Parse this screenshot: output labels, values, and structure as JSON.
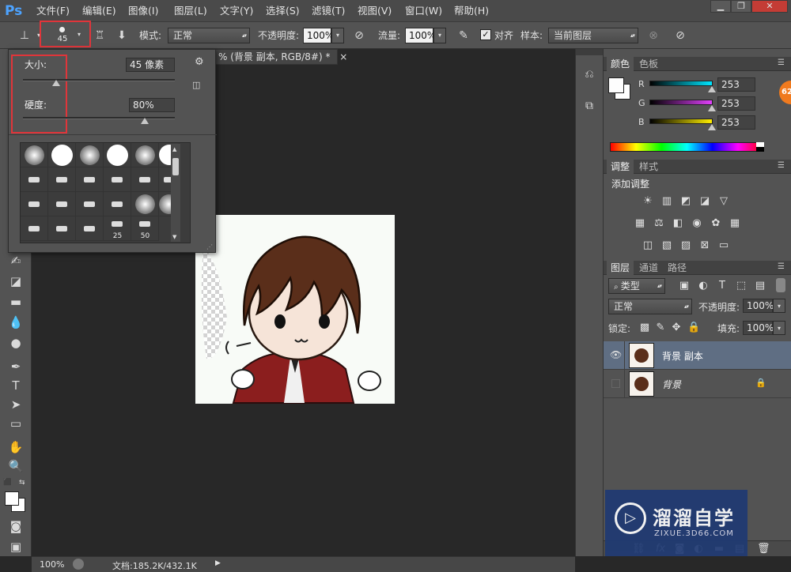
{
  "app": {
    "logo": "Ps"
  },
  "menubar": {
    "items": [
      "文件(F)",
      "编辑(E)",
      "图像(I)",
      "图层(L)",
      "文字(Y)",
      "选择(S)",
      "滤镜(T)",
      "视图(V)",
      "窗口(W)",
      "帮助(H)"
    ],
    "window_controls": [
      "minimize-icon",
      "restore-icon",
      "close-icon"
    ]
  },
  "options": {
    "brush_size_value": "45",
    "mode_label": "模式:",
    "mode_value": "正常",
    "opacity_label": "不透明度:",
    "opacity_value": "100%",
    "flow_label": "流量:",
    "flow_value": "100%",
    "align_label": "对齐",
    "align_checked": true,
    "sample_label": "样本:",
    "sample_value": "当前图层"
  },
  "brush_popup": {
    "size_label": "大小:",
    "size_value": "45 像素",
    "size_fraction": 0.22,
    "hardness_label": "硬度:",
    "hardness_value": "80%",
    "hardness_fraction": 0.8,
    "presets_row4_labels": [
      "25",
      "50"
    ]
  },
  "document_tab": {
    "title": "% (背景 副本, RGB/8#) *",
    "close": "×"
  },
  "color_panel": {
    "tabs": [
      "颜色",
      "色板"
    ],
    "channels": [
      {
        "label": "R",
        "value": "253",
        "color": "#00e5ff"
      },
      {
        "label": "G",
        "value": "253",
        "color": "#e040fb"
      },
      {
        "label": "B",
        "value": "253",
        "color": "#ffee00"
      }
    ],
    "fg_color": "#fdfdfd",
    "badge": "62"
  },
  "adjustments_panel": {
    "tabs": [
      "调整",
      "样式"
    ],
    "title": "添加调整",
    "row1": [
      "brightness-icon",
      "levels-icon",
      "curves-icon",
      "exposure-icon",
      "vibrance-icon"
    ],
    "row2": [
      "hue-saturation-icon",
      "color-balance-icon",
      "black-white-icon",
      "photo-filter-icon",
      "channel-mixer-icon",
      "color-lookup-icon"
    ],
    "row3": [
      "invert-icon",
      "posterize-icon",
      "threshold-icon",
      "selective-color-icon",
      "gradient-map-icon"
    ]
  },
  "layers_panel": {
    "tabs": [
      "图层",
      "通道",
      "路径"
    ],
    "filter_label": "类型",
    "blend_mode": "正常",
    "opacity_label": "不透明度:",
    "opacity_value": "100%",
    "lock_label": "锁定:",
    "fill_label": "填充:",
    "fill_value": "100%",
    "layers": [
      {
        "name": "背景 副本",
        "visible": true,
        "selected": true,
        "locked": false
      },
      {
        "name": "背景",
        "visible": false,
        "selected": false,
        "locked": true
      }
    ]
  },
  "statusbar": {
    "zoom": "100%",
    "doc_info": "文档:185.2K/432.1K"
  },
  "watermark": {
    "title": "溜溜自学",
    "url": "ZIXUE.3D66.COM"
  }
}
